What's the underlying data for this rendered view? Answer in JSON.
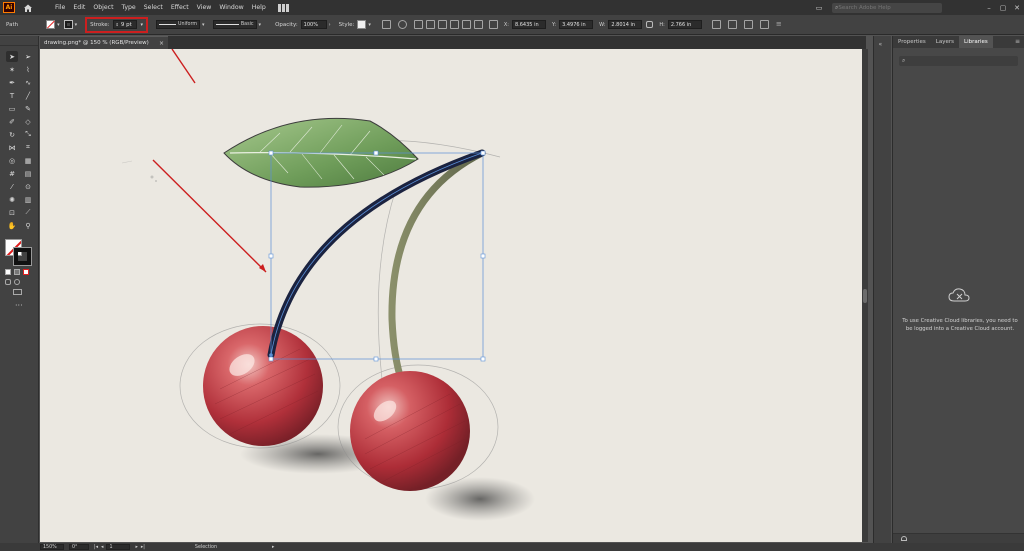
{
  "app": {
    "logo": "Ai",
    "menu": [
      "File",
      "Edit",
      "Object",
      "Type",
      "Select",
      "Effect",
      "View",
      "Window",
      "Help"
    ],
    "search_placeholder": "Search Adobe Help"
  },
  "controlbar": {
    "selection_type": "Path",
    "stroke_label": "Stroke:",
    "stroke_value": "9 pt",
    "profile_label": "Uniform",
    "brush_label": "Basic",
    "opacity_label": "Opacity:",
    "opacity_value": "100%",
    "style_label": "Style:",
    "x_label": "X:",
    "x_value": "8.6435 in",
    "y_label": "Y:",
    "y_value": "3.4976 in",
    "w_label": "W:",
    "w_value": "2.8014 in",
    "h_label": "H:",
    "h_value": "2.766 in"
  },
  "document": {
    "tab_title": "drawing.png* @ 150 % (RGB/Preview)",
    "close": "×"
  },
  "panel": {
    "tabs": [
      "Properties",
      "Layers",
      "Libraries"
    ],
    "active_tab": "Libraries",
    "search_placeholder": "",
    "message": "To use Creative Cloud libraries, you need to be logged into a Creative Cloud account."
  },
  "status": {
    "zoom": "150%",
    "rotation": "0°",
    "artboard": "1",
    "tool": "Selection"
  },
  "colors": {
    "annotation_red": "#cc1f1f",
    "selected_path": "#1b2340",
    "bounding_box": "#5b8fd6"
  }
}
